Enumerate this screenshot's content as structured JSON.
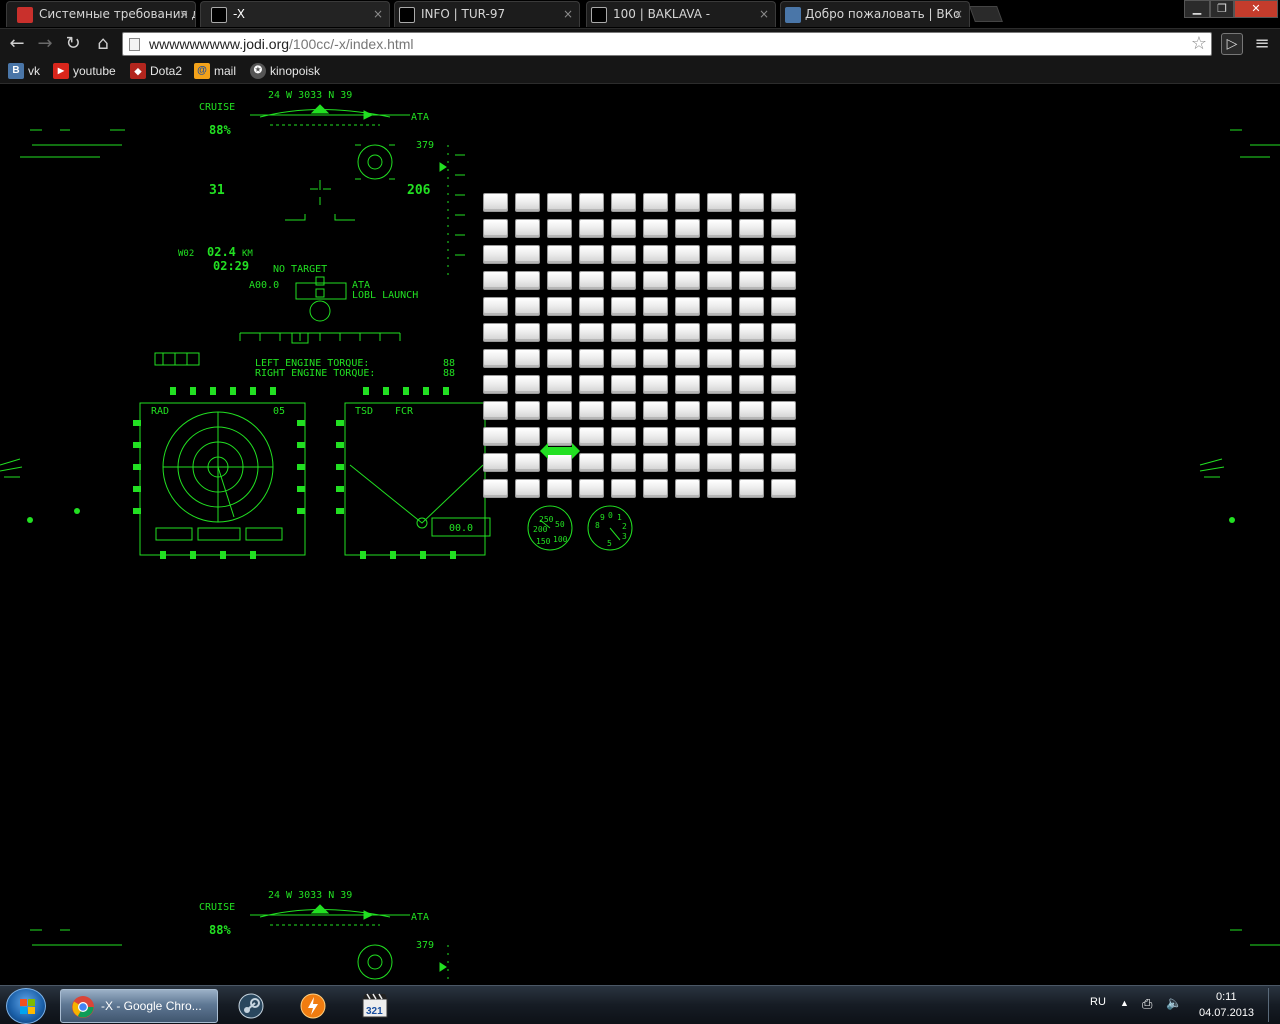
{
  "browser": {
    "tabs": [
      {
        "title": "Системные требования д",
        "icon": "dota2-icon",
        "color": "#c9302c",
        "active": false
      },
      {
        "title": "-X",
        "icon": "blank-page-icon",
        "color": "#000000",
        "active": true
      },
      {
        "title": "INFO | TUR-97",
        "icon": "blank-page-icon",
        "color": "#000000",
        "active": false
      },
      {
        "title": "100 | BAKLAVA -",
        "icon": "blank-page-icon",
        "color": "#000000",
        "active": false
      },
      {
        "title": "Добро пожаловать | ВКо",
        "icon": "vk-icon",
        "color": "#4a76a8",
        "active": false
      }
    ],
    "tab_close_glyph": "×",
    "address": {
      "prefix": "wwwwwwwww.jodi.org",
      "path": "/100cc/-x/index.html"
    },
    "bookmarks": [
      {
        "label": "vk",
        "icon": "vk-icon",
        "glyph": "B",
        "color": "#4a76a8"
      },
      {
        "label": "youtube",
        "icon": "youtube-icon",
        "glyph": "▶",
        "color": "#d9261c"
      },
      {
        "label": "Dota2",
        "icon": "dota2-icon",
        "glyph": "◆",
        "color": "#b3261e"
      },
      {
        "label": "mail",
        "icon": "mail-icon",
        "glyph": "@",
        "color": "#2b6fbf"
      },
      {
        "label": "kinopoisk",
        "icon": "kinopoisk-icon",
        "glyph": "✪",
        "color": "#777777"
      }
    ]
  },
  "hud": {
    "heading_scale": "24 W 3033 N 39",
    "cruise": "CRUISE",
    "cruise_pct": "88%",
    "ata": "ATA",
    "alt_readout": "379",
    "left_num": "31",
    "right_num": "206",
    "waypoint": "W02",
    "range": "02.4",
    "range_unit": "KM",
    "time": "02:29",
    "no_target": "NO TARGET",
    "aoo": "A00.0",
    "ata2": "ATA",
    "lobl_launch": "LOBL LAUNCH",
    "left_torque": "LEFT ENGINE TORQUE:",
    "right_torque": "RIGHT ENGINE TORQUE:",
    "left_torque_val": "88",
    "right_torque_val": "88",
    "rad": "RAD",
    "rad_num": "05",
    "tsd": "TSD",
    "fcr": "FCR",
    "tsd_readout": "00.0",
    "airspeed_ticks": [
      "250",
      "200",
      "50",
      "150",
      "100"
    ],
    "altimeter_ticks": [
      "9",
      "0",
      "1",
      "8",
      "2",
      "3",
      "5"
    ]
  },
  "grid": {
    "rows": 12,
    "cols": 10,
    "key_color": "#eeeeee"
  },
  "taskbar": {
    "active_window": "-X - Google Chro...",
    "apps": [
      "chrome-icon",
      "steam-icon",
      "power-app-icon",
      "mpc-icon"
    ],
    "language": "RU",
    "clock_time": "0:11",
    "clock_date": "04.07.2013"
  },
  "colors": {
    "hud_green": "#22e022",
    "page_bg": "#000000",
    "chrome_dark": "#161616"
  }
}
